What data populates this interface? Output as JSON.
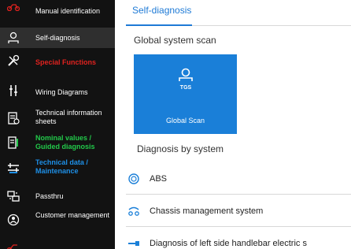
{
  "sidebar": {
    "items": [
      {
        "label": "Manual identification",
        "icon": "motorcycle-icon"
      },
      {
        "label": "Self-diagnosis",
        "icon": "user-search-icon"
      },
      {
        "label": "Special Functions",
        "icon": "tools-icon"
      },
      {
        "label": "Wiring Diagrams",
        "icon": "wiring-icon"
      },
      {
        "label": "Technical information sheets",
        "icon": "document-icon"
      },
      {
        "label": "Nominal values / Guided diagnosis",
        "icon": "gauge-icon"
      },
      {
        "label": "Technical data / Maintenance",
        "icon": "maintenance-icon"
      },
      {
        "label": "Passthru",
        "icon": "passthru-icon"
      },
      {
        "label": "Customer management",
        "icon": "customer-icon"
      },
      {
        "label": "",
        "icon": "motorcycle-icon"
      }
    ]
  },
  "main": {
    "tab_label": "Self-diagnosis",
    "global_scan_title": "Global system scan",
    "tile_badge": "TGS",
    "tile_label": "Global Scan",
    "diagnosis_title": "Diagnosis by system",
    "systems": [
      {
        "label": "ABS",
        "icon": "abs-icon"
      },
      {
        "label": "Chassis management system",
        "icon": "chassis-icon"
      },
      {
        "label": "Diagnosis of left side handlebar electric s",
        "icon": "handlebar-icon"
      }
    ]
  },
  "colors": {
    "accent_blue": "#1a7fd8",
    "sidebar_bg": "#121212",
    "special_red": "#e0221f",
    "nominal_green": "#22c94a",
    "techdata_blue": "#1e8fe6"
  }
}
